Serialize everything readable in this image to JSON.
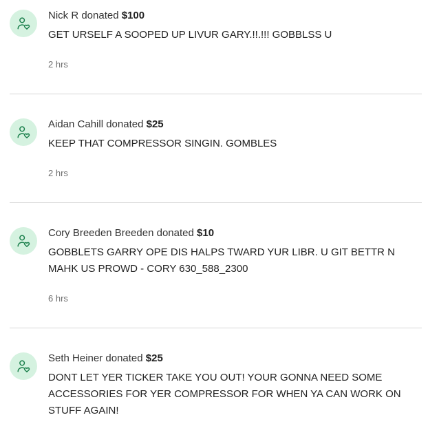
{
  "donations": [
    {
      "name": "Nick R",
      "verb": "donated",
      "amount": "$100",
      "message": "GET URSELF A SOOPED UP LIVUR GARY.!!.!!! GOBBLSS U",
      "time": "2 hrs"
    },
    {
      "name": "Aidan Cahill",
      "verb": "donated",
      "amount": "$25",
      "message": "KEEP THAT COMPRESSOR SINGIN. GOMBLES",
      "time": "2 hrs"
    },
    {
      "name": "Cory Breeden Breeden",
      "verb": "donated",
      "amount": "$10",
      "message": "GOBBLETS GARRY OPE DIS HALPS TWARD YUR LIBR. U GIT BETTR N MAHK US PROWD - CORY 630_588_2300",
      "time": "6 hrs"
    },
    {
      "name": "Seth Heiner",
      "verb": "donated",
      "amount": "$25",
      "message": "DONT LET YER TICKER TAKE YOU OUT! YOUR GONNA NEED SOME ACCESSORIES FOR YER COMPRESSOR FOR WHEN YA CAN WORK ON STUFF AGAIN!",
      "time": ""
    }
  ],
  "icons": {
    "avatar": "donor-heart-icon"
  },
  "colors": {
    "avatar_bg": "#d5f2e0",
    "avatar_icon": "#1a7f4b",
    "divider": "#d6d6d6",
    "time_text": "#6f6f6f"
  }
}
